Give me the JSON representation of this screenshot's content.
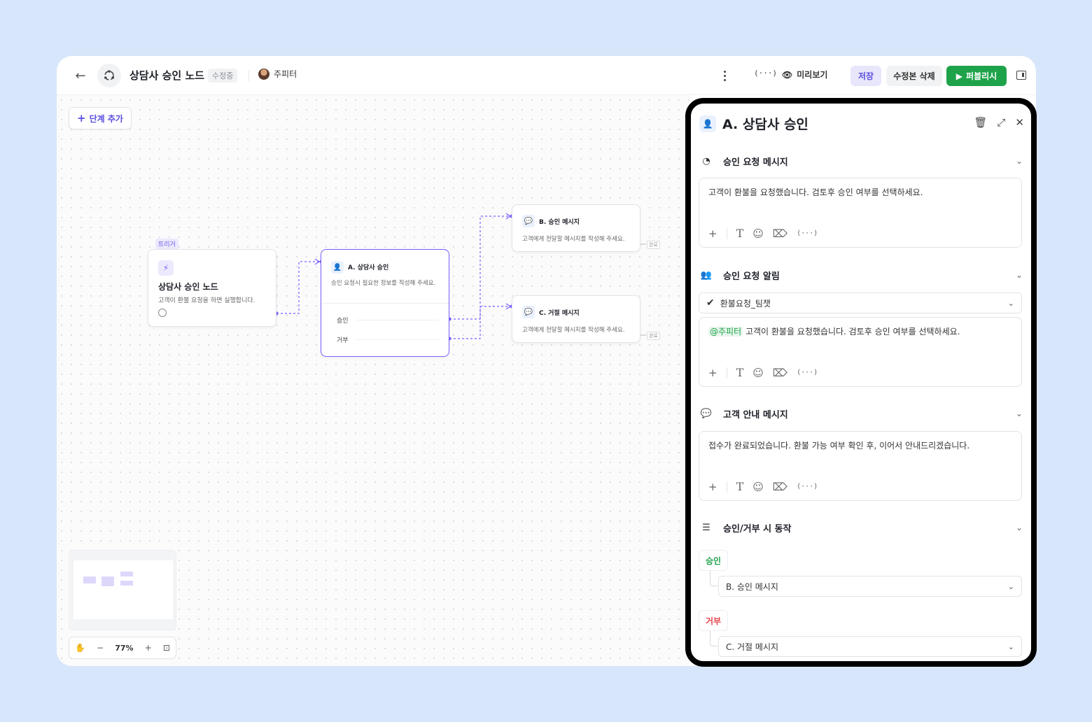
{
  "header": {
    "title": "상담사 승인 노드",
    "status": "수정중",
    "owner": "주피터",
    "variables_label": "(···)",
    "preview_label": "미리보기",
    "save_label": "저장",
    "delete_label": "수정본 삭제",
    "publish_label": "퍼블리시"
  },
  "canvas": {
    "add_step_label": "단계 추가",
    "zoom": "77%",
    "nodes": {
      "trigger": {
        "tag": "트리거",
        "title": "상담사 승인 노드",
        "desc": "고객이 환불 요청을 하면 실행합니다."
      },
      "approval": {
        "title": "A. 상담사 승인",
        "desc": "승인 요청시 필요한 정보를 작성해 주세요.",
        "options": [
          "승인",
          "거부"
        ]
      },
      "approve_msg": {
        "title": "B. 승인 메시지",
        "desc": "고객에게 전달할 메시지를 작성해 주세요.",
        "done": "완료"
      },
      "reject_msg": {
        "title": "C. 거절 메시지",
        "desc": "고객에게 전달할 메시지를 작성해 주세요.",
        "done": "완료"
      }
    }
  },
  "panel": {
    "title": "A. 상담사 승인",
    "sections": {
      "request_msg": {
        "title": "승인 요청 메시지",
        "text": "고객이 환불을 요청했습니다. 검토후 승인 여부를 선택하세요."
      },
      "request_alert": {
        "title": "승인 요청 알림",
        "channel": "환불요청_팀챗",
        "mention": "@주피터",
        "text": " 고객이 환불을 요청했습니다. 검토후 승인 여부를 선택하세요."
      },
      "customer_msg": {
        "title": "고객 안내 메시지",
        "text": "접수가 완료되었습니다. 환불 가능 여부 확인 후, 이어서 안내드리겠습니다."
      },
      "actions": {
        "title": "승인/거부 시 동작",
        "approve_label": "승인",
        "approve_target": "B. 승인 메시지",
        "reject_label": "거부",
        "reject_target": "C. 거절 메시지"
      }
    },
    "toolbar_var": "(···)"
  },
  "colors": {
    "accent": "#5a4ee0",
    "publish": "#1fa34a",
    "approve": "#1fa34a",
    "reject": "#e5484d",
    "background": "#d8e6fb"
  }
}
